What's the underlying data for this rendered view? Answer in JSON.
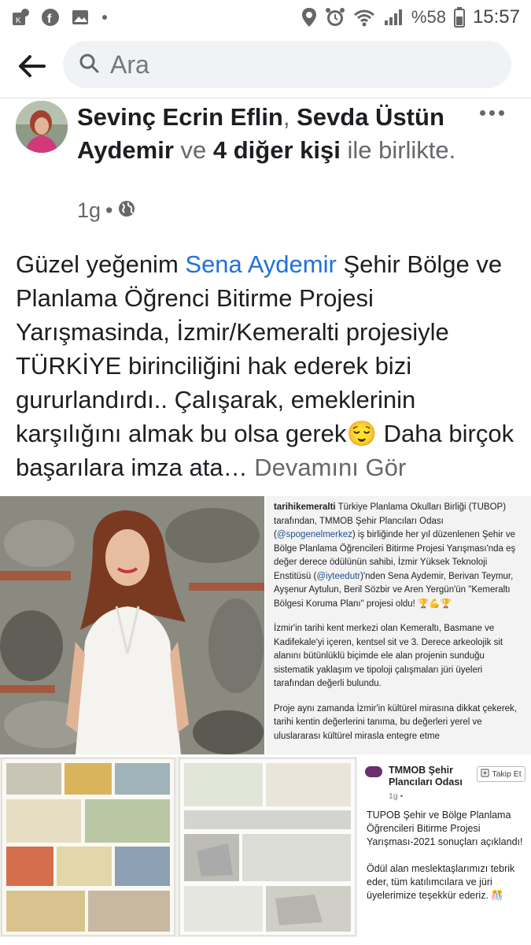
{
  "status_bar": {
    "time": "15:57",
    "battery": "%58",
    "left_icons": [
      "notification-badge-icon",
      "facebook-icon",
      "gallery-icon",
      "dot-icon"
    ],
    "right_icons": [
      "location-icon",
      "alarm-icon",
      "wifi-icon",
      "signal-icon",
      "battery-icon"
    ]
  },
  "search": {
    "placeholder": "Ara"
  },
  "post": {
    "author_1": "Sevinç Ecrin Eflin",
    "separator": ", ",
    "author_2": "Sevda Üstün Aydemir",
    "conj": " ve ",
    "others": "4 diğer kişi",
    "suffix": " ile birlikte.",
    "time": "1g",
    "dot": " • ",
    "privacy_icon": "globe-icon",
    "text_part1": "Güzel yeğenim ",
    "mention": "Sena Aydemir",
    "text_part2": " Şehir Bölge ve Planlama Öğrenci Bitirme Projesi Yarışmasinda, İzmir/Kemeralti projesiyle TÜRKİYE birinciliğini hak ederek bizi gururlandırdı.. Çalışarak, emeklerinin karşılığını almak bu olsa gerek",
    "emoji": "😌",
    "text_part3": " Daha birçok başarılara imza ata… ",
    "see_more": "Devamını Gör"
  },
  "image_text": {
    "handle": "tarihikemeralti",
    "line_a": " Türkiye Planlama Okulları Birliği (TUBOP) tarafından, TMMOB Şehir Plancıları Odası (",
    "link_a": "@spogenelmerkez",
    "line_b": ") iş birliğinde her yıl düzenlenen Şehir ve Bölge Planlama Öğrencileri Bitirme Projesi Yarışması'nda eş değer derece ödülünün sahibi, İzmir Yüksek Teknoloji Enstitüsü (",
    "link_b": "@iyteedutr",
    "line_c": ")'nden Sena Aydemir, Berivan Teymur, Ayşenur Aytulun, Beril Sözbir ve Aren Yergün'ün \"Kemeraltı Bölgesi Koruma Planı\" projesi oldu! 🏆💪🏆",
    "para2": "İzmir'in tarihi kent merkezi olan Kemeraltı, Basmane ve Kadifekale'yi içeren, kentsel sit ve 3. Derece arkeolojik sit alanını bütünlüklü biçimde ele alan projenin sunduğu sistematik yaklaşım ve tipoloji çalışmaları jüri üyeleri tarafından değerli bulundu.",
    "para3": "Proje aynı zamanda İzmir'in kültürel mirasına dikkat çekerek, tarihi kentin değerlerini tanıma, bu değerleri yerel ve uluslararası kültürel mirasla entegre etme"
  },
  "tmmob_card": {
    "name": "TMMOB Şehir Plancıları Odası",
    "follow": "Takip Et",
    "time": "1g",
    "text1": "TUPOB Şehir ve Bölge Planlama Öğrencileri Bitirme Projesi Yarışması-2021 sonuçları açıklandı!",
    "text2": "Ödül alan meslektaşlarımızı tebrik eder, tüm katılımcılara ve jüri üyelerimize teşekkür ederiz. 🎊"
  }
}
